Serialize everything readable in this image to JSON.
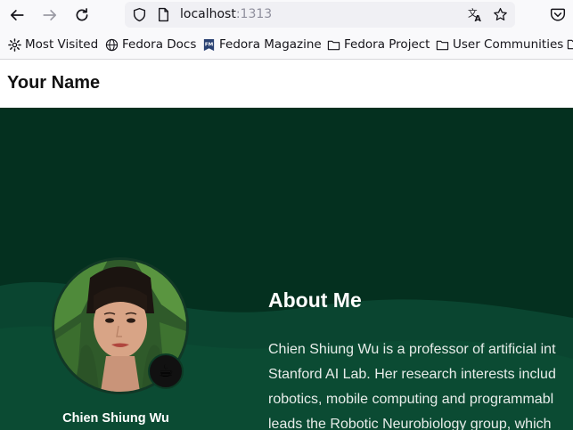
{
  "browser": {
    "url_host": "localhost",
    "url_port": ":1313",
    "icons": [
      "back-arrow-icon",
      "forward-arrow-icon",
      "reload-icon",
      "shield-icon",
      "page-icon",
      "translate-icon",
      "star-icon",
      "pocket-icon"
    ]
  },
  "bookmarks": [
    {
      "label": "Most Visited",
      "icon": "gear-icon"
    },
    {
      "label": "Fedora Docs",
      "icon": "globe-icon"
    },
    {
      "label": "Fedora Magazine",
      "icon": "fm-icon"
    },
    {
      "label": "Fedora Project",
      "icon": "folder-icon"
    },
    {
      "label": "User Communities",
      "icon": "folder-icon"
    }
  ],
  "site": {
    "title": "Your Name"
  },
  "profile": {
    "name": "Chien Shiung Wu",
    "badge": "☕"
  },
  "about": {
    "heading": "About Me",
    "lines": [
      "Chien Shiung Wu is a professor of artificial int",
      "Stanford AI Lab. Her research interests includ",
      "robotics, mobile computing and programmabl",
      "leads the Robotic Neurobiology group, which"
    ]
  },
  "colors": {
    "hero_bg": "#04301f",
    "wave": "#0b4a31"
  }
}
